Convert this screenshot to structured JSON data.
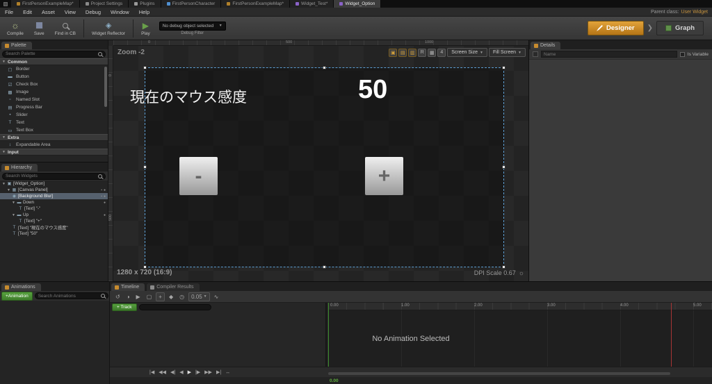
{
  "window": {
    "doc_tabs": [
      {
        "label": "FirstPersonExampleMap*"
      },
      {
        "label": "Project Settings"
      },
      {
        "label": "Plugins"
      },
      {
        "label": "FirstPersonCharacter"
      },
      {
        "label": "FirstPersonExampleMap*"
      },
      {
        "label": "Widget_Test*"
      },
      {
        "label": "Widget_Option"
      }
    ],
    "menus": [
      "File",
      "Edit",
      "Asset",
      "View",
      "Debug",
      "Window",
      "Help"
    ],
    "parent_class_label": "Parent class:",
    "parent_class_value": "User Widget"
  },
  "toolbar": {
    "compile": "Compile",
    "save": "Save",
    "find_in_cb": "Find in CB",
    "widget_reflector": "Widget Reflector",
    "play": "Play",
    "debug_object": "No debug object selected",
    "debug_filter": "Debug Filter",
    "designer": "Designer",
    "graph": "Graph"
  },
  "palette": {
    "title": "Palette",
    "search_placeholder": "Search Palette",
    "groups": [
      {
        "label": "Common",
        "items": [
          {
            "icon": "▢",
            "label": "Border"
          },
          {
            "icon": "▬",
            "label": "Button"
          },
          {
            "icon": "☑",
            "label": "Check Box"
          },
          {
            "icon": "▩",
            "label": "Image"
          },
          {
            "icon": "▫",
            "label": "Named Slot"
          },
          {
            "icon": "▤",
            "label": "Progress Bar"
          },
          {
            "icon": "•",
            "label": "Slider"
          },
          {
            "icon": "T",
            "label": "Text"
          },
          {
            "icon": "▭",
            "label": "Text Box"
          }
        ]
      },
      {
        "label": "Extra",
        "items": [
          {
            "icon": "↕",
            "label": "Expandable Area"
          }
        ]
      },
      {
        "label": "Input",
        "items": []
      }
    ]
  },
  "hierarchy": {
    "title": "Hierarchy",
    "search_placeholder": "Search Widgets",
    "rows": [
      {
        "icon": "▣",
        "label": "[Widget_Option]"
      },
      {
        "icon": "▦",
        "label": "[Canvas Panel]"
      },
      {
        "icon": "◉",
        "label": "[Background Blur]"
      },
      {
        "icon": "▬",
        "label": "Down"
      },
      {
        "icon": "T",
        "label": "[Text] \"-\""
      },
      {
        "icon": "▬",
        "label": "Up"
      },
      {
        "icon": "T",
        "label": "[Text] \"+\""
      },
      {
        "icon": "T",
        "label": "[Text] \"現在のマウス感度\""
      },
      {
        "icon": "T",
        "label": "[Text] \"50\""
      }
    ]
  },
  "designer": {
    "zoom_label": "Zoom -2",
    "resolution": "1280 x 720 (16:9)",
    "dpi": "DPI Scale 0.67",
    "screen_size": "Screen Size",
    "fill_screen": "Fill Screen",
    "toolbar_icons": [
      "▣",
      "▤",
      "▥",
      "R",
      "▦",
      "4"
    ],
    "ruler_h": [
      "0",
      "500",
      "1000"
    ],
    "ruler_v": [
      "0",
      "500"
    ],
    "widget": {
      "label_text": "現在のマウス感度",
      "value_text": "50",
      "minus": "-",
      "plus": "+"
    }
  },
  "details": {
    "title": "Details",
    "name_placeholder": "Name",
    "is_variable": "Is Variable"
  },
  "animations": {
    "title": "Animations",
    "add_button": "+Animation",
    "search_placeholder": "Search Animations"
  },
  "sequencer": {
    "tab_timeline": "Timeline",
    "tab_compiler": "Compiler Results",
    "icons": [
      "↺",
      "◑",
      "▶",
      "▢",
      "+",
      "◆",
      "◷"
    ],
    "snap_value": "0.05",
    "curve_icon": "∿",
    "track_button": "+ Track",
    "no_animation": "No Animation Selected",
    "ruler": [
      "0.00",
      "1.00",
      "2.00",
      "3.00",
      "4.00",
      "5.00"
    ],
    "current_time": "0.00",
    "transport": [
      "|◀",
      "◀◀",
      "◀|",
      "◀",
      "▶",
      "|▶",
      "▶▶",
      "▶|",
      "↔"
    ]
  }
}
